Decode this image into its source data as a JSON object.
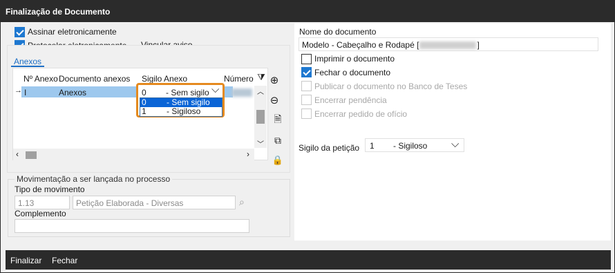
{
  "window": {
    "title": "Finalização de Documento"
  },
  "left": {
    "assinar_label": "Assinar eletronicamente",
    "assinar_checked": true,
    "protocolar_label": "Protocolar eletronicamente",
    "protocolar_checked": true,
    "vincular_link": "Vincular aviso",
    "tab_label": "Anexos",
    "grid": {
      "columns": [
        "Nº Anexo",
        "Documento anexos",
        "Sigilo Anexo",
        "Número"
      ],
      "rows": [
        {
          "numero": "I",
          "documento": "Anexos",
          "sigilo": "0",
          "sigilo_desc": "- Sem sigilo"
        }
      ]
    },
    "dropdown": {
      "current_code": "0",
      "current_desc": "- Sem sigilo",
      "options": [
        {
          "code": "0",
          "desc": "- Sem sigilo",
          "selected": true
        },
        {
          "code": "1",
          "desc": "- Sigiloso",
          "selected": false
        }
      ]
    },
    "side_icons": [
      "filter-icon",
      "add-circle-icon",
      "remove-circle-icon",
      "view-document-icon",
      "copy-document-icon",
      "lock-icon"
    ]
  },
  "movimentacao": {
    "legend": "Movimentação a ser lançada no processo",
    "tipo_label": "Tipo de movimento",
    "tipo_code": "1.13",
    "tipo_desc": "Petição Elaborada - Diversas",
    "complemento_label": "Complemento",
    "complemento_value": ""
  },
  "right": {
    "nome_label": "Nome do documento",
    "nome_value_prefix": "Modelo - Cabeçalho e Rodapé [",
    "nome_value_suffix": "]",
    "options": [
      {
        "label": "Imprimir o documento",
        "checked": false,
        "disabled": false
      },
      {
        "label": "Fechar o documento",
        "checked": true,
        "disabled": false
      },
      {
        "label": "Publicar o documento no Banco de Teses",
        "checked": false,
        "disabled": true
      },
      {
        "label": "Encerrar pendência",
        "checked": false,
        "disabled": true
      },
      {
        "label": "Encerrar pedido de ofício",
        "checked": false,
        "disabled": true
      }
    ],
    "sigilo_label": "Sigilo da petição",
    "sigilo_code": "1",
    "sigilo_desc": "- Sigiloso"
  },
  "footer": {
    "finalizar": "Finalizar",
    "fechar": "Fechar"
  },
  "colors": {
    "accent": "#1e78d0",
    "highlight": "#e58a1f",
    "selection": "#9dc8ee",
    "titlebar": "#2b2b2b"
  }
}
